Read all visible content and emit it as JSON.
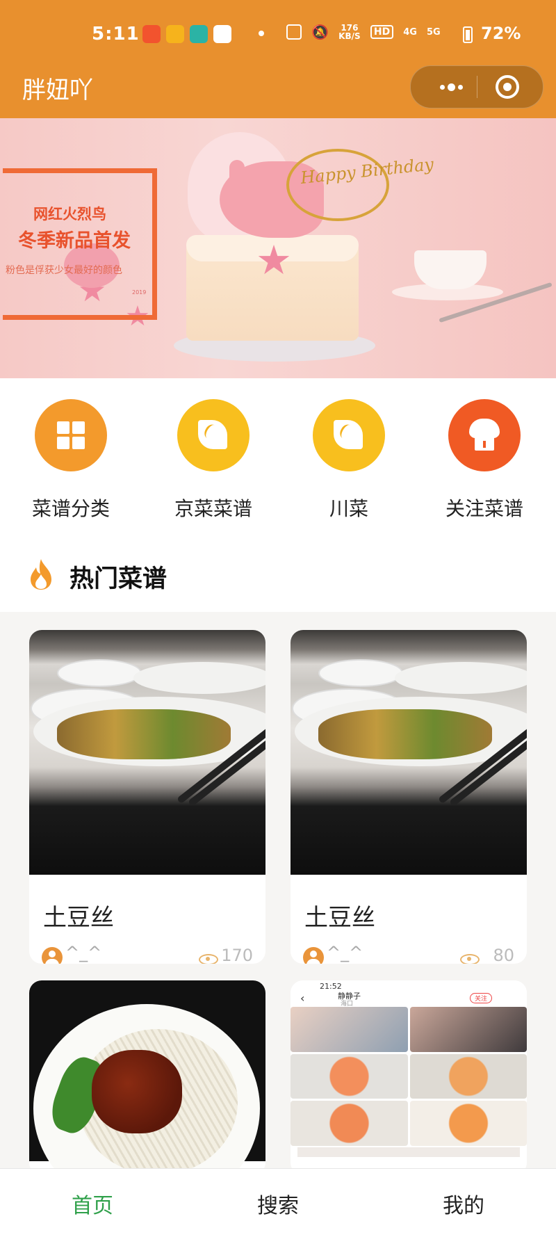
{
  "status_bar": {
    "time": "5:11",
    "net_speed": "176 KB/S",
    "hd": "HD",
    "signal_1": "4G",
    "signal_2": "5G",
    "battery": "72%"
  },
  "navbar": {
    "title": "胖妞吖"
  },
  "banner": {
    "headline_1": "网红火烈鸟",
    "headline_2": "冬季新品首发",
    "tagline": "粉色是俘获少女最好的颜色",
    "year": "2019",
    "topper_text": "Happy Birthday"
  },
  "categories": [
    {
      "label": "菜谱分类",
      "color": "#f39a2c",
      "icon": "grid-icon"
    },
    {
      "label": "京菜菜谱",
      "color": "#f8bf1e",
      "icon": "leaf-icon"
    },
    {
      "label": "川菜",
      "color": "#f8bf1e",
      "icon": "leaf-icon"
    },
    {
      "label": "关注菜谱",
      "color": "#f05a24",
      "icon": "chef-hat-icon"
    }
  ],
  "hot_section": {
    "title": "热门菜谱",
    "icon": "flame-icon"
  },
  "recipes": [
    {
      "title": "土豆丝",
      "author": "^_^",
      "views": "170"
    },
    {
      "title": "土豆丝",
      "author": "^_^",
      "views": "80"
    },
    {
      "title": "",
      "author": "",
      "views": ""
    },
    {
      "title": "",
      "author": "",
      "views": ""
    }
  ],
  "screenshot_card": {
    "time": "21:52",
    "user": "静静子",
    "location": "海口",
    "follow": "关注"
  },
  "tabbar": {
    "items": [
      {
        "label": "首页",
        "active": true
      },
      {
        "label": "搜索",
        "active": false
      },
      {
        "label": "我的",
        "active": false
      }
    ],
    "active_color": "#2fa04a"
  },
  "colors": {
    "brand_orange": "#e8902e"
  }
}
